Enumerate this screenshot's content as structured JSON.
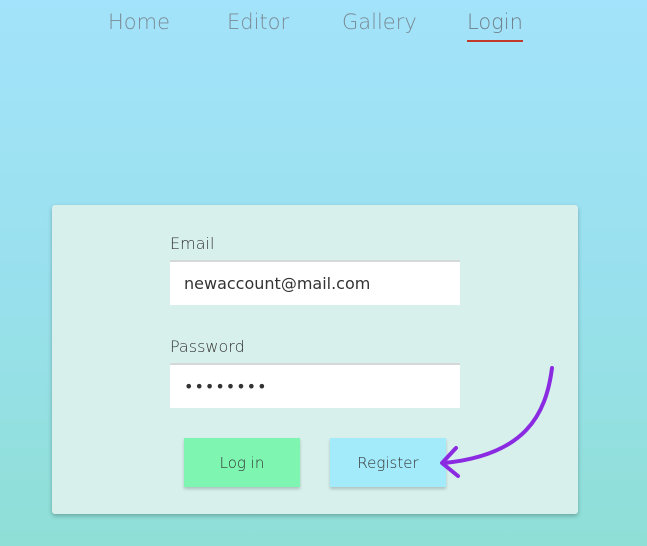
{
  "nav": {
    "items": [
      {
        "label": "Home",
        "active": false
      },
      {
        "label": "Editor",
        "active": false
      },
      {
        "label": "Gallery",
        "active": false
      },
      {
        "label": "Login",
        "active": true
      }
    ]
  },
  "login_form": {
    "email_label": "Email",
    "email_value": "newaccount@mail.com",
    "password_label": "Password",
    "password_value": "secretpw",
    "login_label": "Log in",
    "register_label": "Register"
  },
  "annotation": {
    "arrow_icon": "curved-arrow-icon",
    "arrow_color": "#8a2be2"
  },
  "colors": {
    "background_top": "#a3e3fb",
    "background_bottom": "#8fdfd6",
    "card": "#d7f0ec",
    "login_button": "#7ef5b0",
    "register_button": "#a3ebfb",
    "active_underline": "#c0392b"
  }
}
